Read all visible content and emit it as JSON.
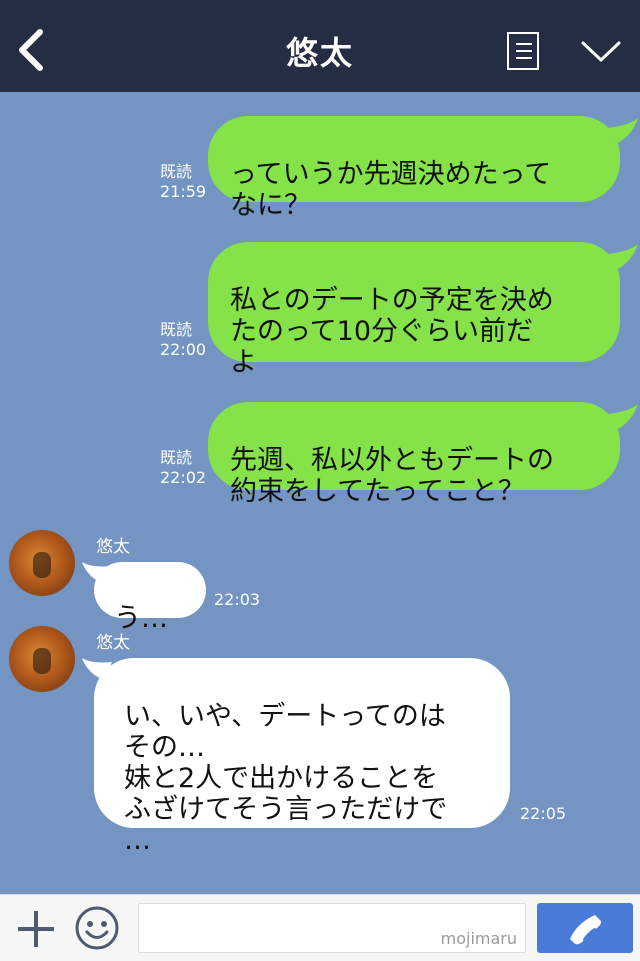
{
  "header": {
    "title": "悠太"
  },
  "messages_sent": [
    {
      "text": "っていうか先週決めたって\nなに？",
      "read": "既読",
      "time": "21:59"
    },
    {
      "text": "私とのデートの予定を決め\nたのって10分ぐらい前だ\nよ",
      "read": "既読",
      "time": "22:00"
    },
    {
      "text": "先週、私以外ともデートの\n約束をしてたってこと？",
      "read": "既読",
      "time": "22:02"
    }
  ],
  "messages_received": [
    {
      "sender": "悠太",
      "text": "う…",
      "time": "22:03"
    },
    {
      "sender": "悠太",
      "text": "い、いや、デートってのは\nその…\n妹と2人で出かけることを\nふざけてそう言っただけで\n…",
      "time": "22:05"
    }
  ],
  "input": {
    "watermark": "mojimaru"
  },
  "icons": [
    "back-arrow-icon",
    "menu-icon",
    "chevron-down-icon",
    "plus-icon",
    "emoji-icon",
    "phone-icon"
  ]
}
